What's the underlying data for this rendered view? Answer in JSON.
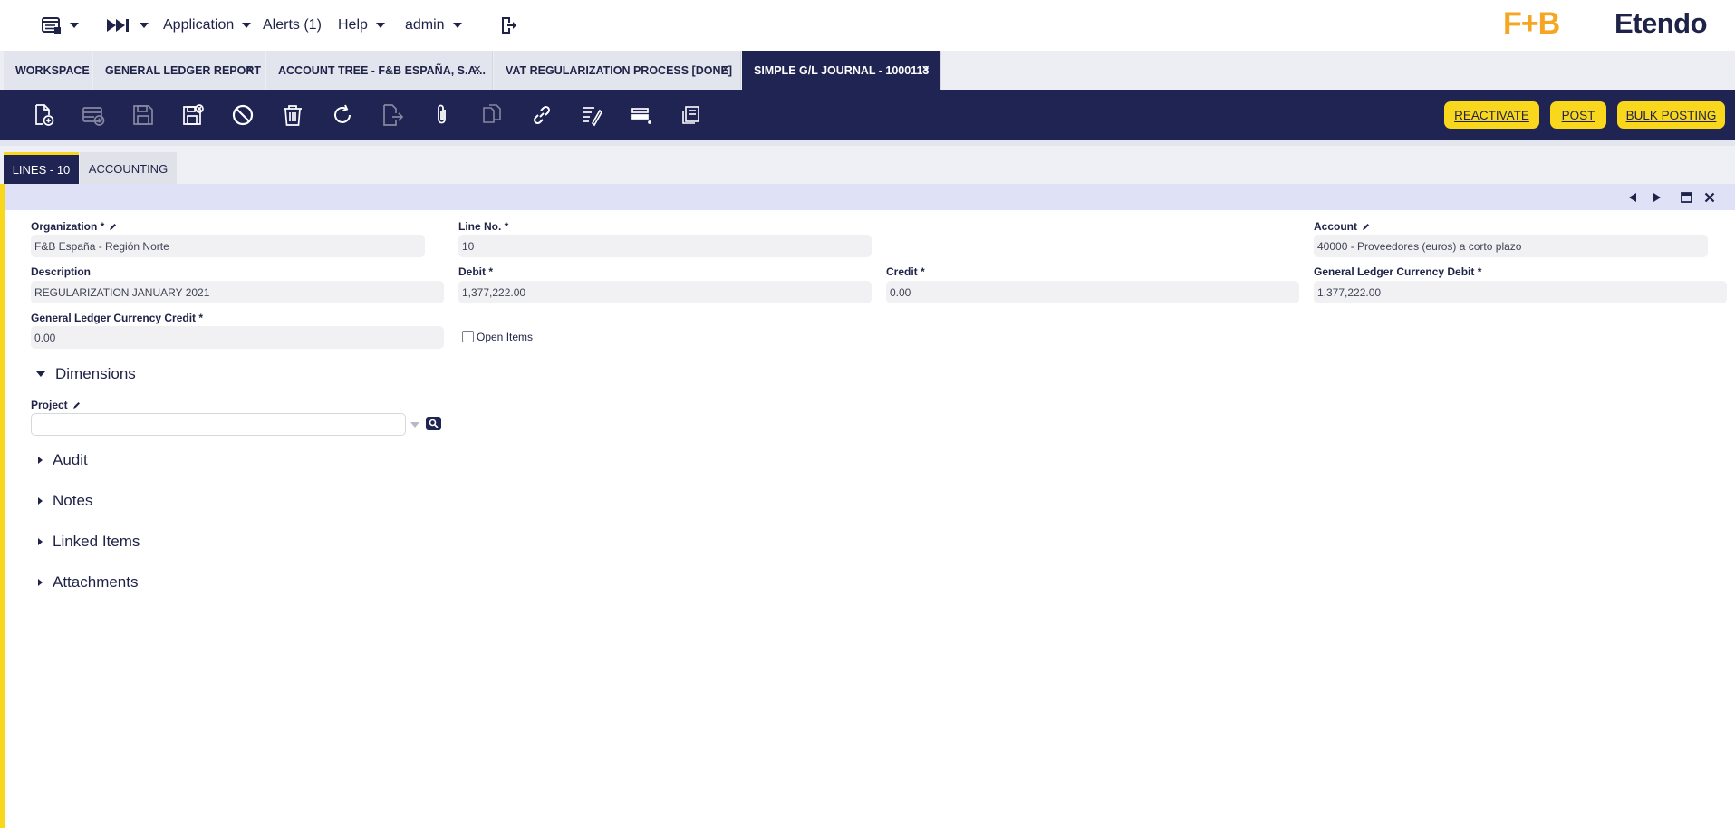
{
  "topbar": {
    "application": "Application",
    "alerts": "Alerts (1)",
    "help": "Help",
    "user": "admin"
  },
  "logo": {
    "brand": "F+B",
    "name": "Etendo"
  },
  "window_tabs": [
    {
      "label": "WORKSPACE",
      "closable": false
    },
    {
      "label": "GENERAL LEDGER REPORT",
      "closable": true
    },
    {
      "label": "ACCOUNT TREE - F&B ESPAÑA, S.A...",
      "closable": true
    },
    {
      "label": "VAT REGULARIZATION PROCESS [DONE]",
      "closable": true
    },
    {
      "label": "SIMPLE G/L JOURNAL - 1000113",
      "closable": true,
      "active": true
    }
  ],
  "close_glyph": "×",
  "toolbar": {
    "icons": [
      "new-document-icon",
      "new-row-icon",
      "save-icon",
      "save-close-icon",
      "undo-icon",
      "delete-icon",
      "refresh-icon",
      "export-icon",
      "attachment-icon",
      "clone-icon",
      "link-icon",
      "audit-trail-icon",
      "grid-view-icon",
      "print-icon"
    ],
    "reactivate": "REACTIVATE",
    "post": "POST",
    "bulk_posting": "BULK POSTING"
  },
  "subtabs": [
    {
      "label": "LINES - 10",
      "active": true
    },
    {
      "label": "ACCOUNTING",
      "active": false
    }
  ],
  "form": {
    "organization_label": "Organization *",
    "organization_value": "F&B España - Región Norte",
    "line_no_label": "Line No. *",
    "line_no_value": "10",
    "account_label": "Account",
    "account_value": "40000 - Proveedores (euros) a corto plazo",
    "description_label": "Description",
    "description_value": "REGULARIZATION JANUARY 2021",
    "debit_label": "Debit *",
    "debit_value": "1,377,222.00",
    "credit_label": "Credit *",
    "credit_value": "0.00",
    "gl_debit_label": "General Ledger Currency Debit *",
    "gl_debit_value": "1,377,222.00",
    "gl_credit_label": "General Ledger Currency Credit *",
    "gl_credit_value": "0.00",
    "open_items_label": "Open Items",
    "open_items_checked": false,
    "project_label": "Project",
    "project_value": ""
  },
  "sections": {
    "dimensions": "Dimensions",
    "audit": "Audit",
    "notes": "Notes",
    "linked_items": "Linked Items",
    "attachments": "Attachments"
  },
  "colors": {
    "navy": "#202452",
    "accent": "#f9d71c",
    "logo_orange": "#f5a623"
  }
}
